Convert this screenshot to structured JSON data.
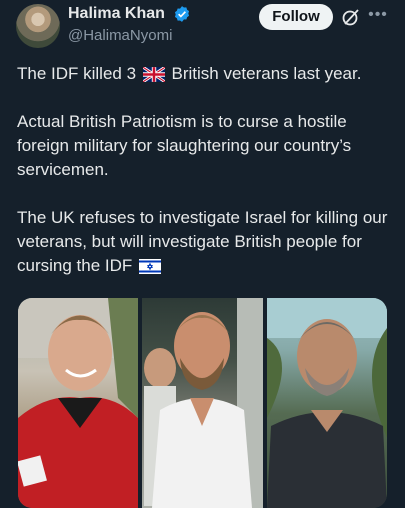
{
  "author": {
    "display_name": "Halima Khan",
    "handle": "@HalimaNyomi",
    "verified": true
  },
  "actions": {
    "follow_label": "Follow",
    "grok_icon": "grok-icon",
    "more_icon": "more-dots-icon"
  },
  "post": {
    "p1_before": "The IDF killed 3",
    "p1_flag": "🇬🇧",
    "p1_after": "British veterans last year.",
    "p2": "Actual British Patriotism is to curse a hostile foreign military for slaughtering our country’s servicemen.",
    "p3": "The UK refuses to investigate Israel for killing our veterans, but will investigate British people for cursing the IDF",
    "p3_flag": "🇮🇱"
  },
  "colors": {
    "background": "#15202b",
    "text": "#e7e9ea",
    "muted": "#8b98a5",
    "verified_blue": "#1d9bf0",
    "follow_bg": "#eff3f4"
  },
  "media": {
    "photos": [
      "man-in-red-jacket",
      "man-in-white-polo",
      "man-in-dark-shirt"
    ]
  }
}
